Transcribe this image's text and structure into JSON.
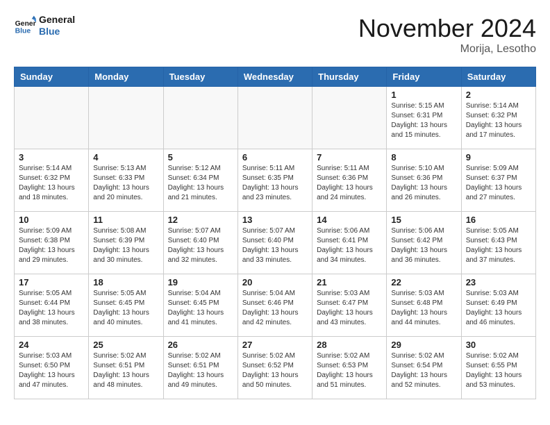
{
  "header": {
    "logo_line1": "General",
    "logo_line2": "Blue",
    "month_title": "November 2024",
    "location": "Morija, Lesotho"
  },
  "weekdays": [
    "Sunday",
    "Monday",
    "Tuesday",
    "Wednesday",
    "Thursday",
    "Friday",
    "Saturday"
  ],
  "weeks": [
    [
      {
        "day": "",
        "info": ""
      },
      {
        "day": "",
        "info": ""
      },
      {
        "day": "",
        "info": ""
      },
      {
        "day": "",
        "info": ""
      },
      {
        "day": "",
        "info": ""
      },
      {
        "day": "1",
        "info": "Sunrise: 5:15 AM\nSunset: 6:31 PM\nDaylight: 13 hours and 15 minutes."
      },
      {
        "day": "2",
        "info": "Sunrise: 5:14 AM\nSunset: 6:32 PM\nDaylight: 13 hours and 17 minutes."
      }
    ],
    [
      {
        "day": "3",
        "info": "Sunrise: 5:14 AM\nSunset: 6:32 PM\nDaylight: 13 hours and 18 minutes."
      },
      {
        "day": "4",
        "info": "Sunrise: 5:13 AM\nSunset: 6:33 PM\nDaylight: 13 hours and 20 minutes."
      },
      {
        "day": "5",
        "info": "Sunrise: 5:12 AM\nSunset: 6:34 PM\nDaylight: 13 hours and 21 minutes."
      },
      {
        "day": "6",
        "info": "Sunrise: 5:11 AM\nSunset: 6:35 PM\nDaylight: 13 hours and 23 minutes."
      },
      {
        "day": "7",
        "info": "Sunrise: 5:11 AM\nSunset: 6:36 PM\nDaylight: 13 hours and 24 minutes."
      },
      {
        "day": "8",
        "info": "Sunrise: 5:10 AM\nSunset: 6:36 PM\nDaylight: 13 hours and 26 minutes."
      },
      {
        "day": "9",
        "info": "Sunrise: 5:09 AM\nSunset: 6:37 PM\nDaylight: 13 hours and 27 minutes."
      }
    ],
    [
      {
        "day": "10",
        "info": "Sunrise: 5:09 AM\nSunset: 6:38 PM\nDaylight: 13 hours and 29 minutes."
      },
      {
        "day": "11",
        "info": "Sunrise: 5:08 AM\nSunset: 6:39 PM\nDaylight: 13 hours and 30 minutes."
      },
      {
        "day": "12",
        "info": "Sunrise: 5:07 AM\nSunset: 6:40 PM\nDaylight: 13 hours and 32 minutes."
      },
      {
        "day": "13",
        "info": "Sunrise: 5:07 AM\nSunset: 6:40 PM\nDaylight: 13 hours and 33 minutes."
      },
      {
        "day": "14",
        "info": "Sunrise: 5:06 AM\nSunset: 6:41 PM\nDaylight: 13 hours and 34 minutes."
      },
      {
        "day": "15",
        "info": "Sunrise: 5:06 AM\nSunset: 6:42 PM\nDaylight: 13 hours and 36 minutes."
      },
      {
        "day": "16",
        "info": "Sunrise: 5:05 AM\nSunset: 6:43 PM\nDaylight: 13 hours and 37 minutes."
      }
    ],
    [
      {
        "day": "17",
        "info": "Sunrise: 5:05 AM\nSunset: 6:44 PM\nDaylight: 13 hours and 38 minutes."
      },
      {
        "day": "18",
        "info": "Sunrise: 5:05 AM\nSunset: 6:45 PM\nDaylight: 13 hours and 40 minutes."
      },
      {
        "day": "19",
        "info": "Sunrise: 5:04 AM\nSunset: 6:45 PM\nDaylight: 13 hours and 41 minutes."
      },
      {
        "day": "20",
        "info": "Sunrise: 5:04 AM\nSunset: 6:46 PM\nDaylight: 13 hours and 42 minutes."
      },
      {
        "day": "21",
        "info": "Sunrise: 5:03 AM\nSunset: 6:47 PM\nDaylight: 13 hours and 43 minutes."
      },
      {
        "day": "22",
        "info": "Sunrise: 5:03 AM\nSunset: 6:48 PM\nDaylight: 13 hours and 44 minutes."
      },
      {
        "day": "23",
        "info": "Sunrise: 5:03 AM\nSunset: 6:49 PM\nDaylight: 13 hours and 46 minutes."
      }
    ],
    [
      {
        "day": "24",
        "info": "Sunrise: 5:03 AM\nSunset: 6:50 PM\nDaylight: 13 hours and 47 minutes."
      },
      {
        "day": "25",
        "info": "Sunrise: 5:02 AM\nSunset: 6:51 PM\nDaylight: 13 hours and 48 minutes."
      },
      {
        "day": "26",
        "info": "Sunrise: 5:02 AM\nSunset: 6:51 PM\nDaylight: 13 hours and 49 minutes."
      },
      {
        "day": "27",
        "info": "Sunrise: 5:02 AM\nSunset: 6:52 PM\nDaylight: 13 hours and 50 minutes."
      },
      {
        "day": "28",
        "info": "Sunrise: 5:02 AM\nSunset: 6:53 PM\nDaylight: 13 hours and 51 minutes."
      },
      {
        "day": "29",
        "info": "Sunrise: 5:02 AM\nSunset: 6:54 PM\nDaylight: 13 hours and 52 minutes."
      },
      {
        "day": "30",
        "info": "Sunrise: 5:02 AM\nSunset: 6:55 PM\nDaylight: 13 hours and 53 minutes."
      }
    ]
  ]
}
